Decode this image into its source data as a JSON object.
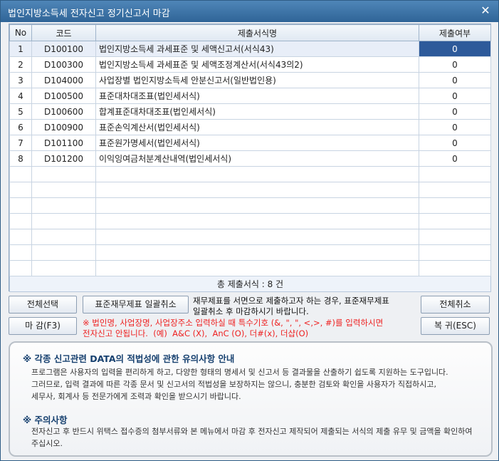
{
  "window": {
    "title": "법인지방소득세 전자신고 정기신고서 마감",
    "close_icon": "close-icon"
  },
  "grid": {
    "headers": [
      "No",
      "코드",
      "제출서식명",
      "제출여부"
    ],
    "rows": [
      {
        "no": "1",
        "code": "D100100",
        "name": "법인지방소득세 과세표준 및 세액신고서(서식43)",
        "status": "0"
      },
      {
        "no": "2",
        "code": "D100300",
        "name": "법인지방소득세 과세표준 및 세액조정계산서(서식43의2)",
        "status": "0"
      },
      {
        "no": "3",
        "code": "D104000",
        "name": "사업장별 법인지방소득세 안분신고서(일반법인용)",
        "status": "0"
      },
      {
        "no": "4",
        "code": "D100500",
        "name": "표준대차대조표(법인세서식)",
        "status": "0"
      },
      {
        "no": "5",
        "code": "D100600",
        "name": "합계표준대차대조표(법인세서식)",
        "status": "0"
      },
      {
        "no": "6",
        "code": "D100900",
        "name": "표준손익계산서(법인세서식)",
        "status": "0"
      },
      {
        "no": "7",
        "code": "D101100",
        "name": "표준원가명세서(법인세서식)",
        "status": "0"
      },
      {
        "no": "8",
        "code": "D101200",
        "name": "이익잉여금처분계산내역(법인세서식)",
        "status": "0"
      }
    ],
    "total": "총 제출서식 : 8 건"
  },
  "buttons": {
    "select_all": "전체선택",
    "cancel_standard": "표준재무제표 일괄취소",
    "cancel_all": "전체취소",
    "close_f3": "마 감(F3)",
    "restore_esc": "복 귀(ESC)"
  },
  "notes": {
    "standard": "재무제표를 서면으로 제출하고자 하는 경우, 표준재무제표\n일괄취소 후 마감하시기 바랍니다.",
    "special": "※ 법인명, 사업장명, 사업장주소 입력하실 때 특수기호 (&, \", \", <,>, #)를 입력하시면\n전자신고 안됩니다.  (예)  A&C (X),  AnC (O), 더#(x), 더샵(O)"
  },
  "notice": {
    "title1": "※ 각종 신고관련 DATA의 적법성에 관한 유의사항 안내",
    "body1": "프로그램은 사용자의 입력을 편리하게 하고, 다양한 형태의 명세서 및 신고서 등 결과물을 산출하기 쉽도록 지원하는 도구입니다.\n그러므로, 입력 결과에 따른 각종 문서 및 신고서의 적법성을 보장하지는 않으니, 충분한 검토와 확인을 사용자가 직접하시고,\n세무사, 회계사 등 전문가에게 조력과 확인을 받으시기 바랍니다.",
    "title2": "※ 주의사항",
    "body2": "전자신고 후 반드시 위택스 접수증의 첨부서류와 본 메뉴에서 마감 후 전자신고 제작되어 제출되는 서식의 제출 유무 및 금액을 확인하여\n주십시오."
  }
}
